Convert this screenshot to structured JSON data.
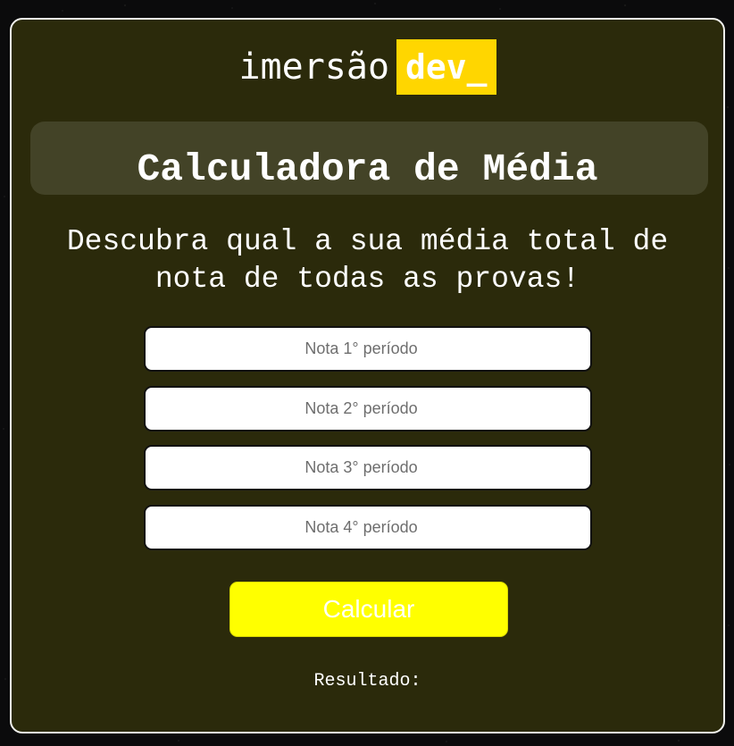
{
  "logo": {
    "text": "imersão",
    "badge": "dev_"
  },
  "title": "Calculadora de Média",
  "subtitle": "Descubra qual a sua média total de nota de todas as provas!",
  "inputs": [
    {
      "placeholder": "Nota 1° período",
      "value": ""
    },
    {
      "placeholder": "Nota 2° período",
      "value": ""
    },
    {
      "placeholder": "Nota 3° período",
      "value": ""
    },
    {
      "placeholder": "Nota 4° período",
      "value": ""
    }
  ],
  "button": {
    "label": "Calcular"
  },
  "result": {
    "label": "Resultado:"
  },
  "colors": {
    "card_background": "#2b2a0b",
    "title_bar": "#434327",
    "logo_badge": "#ffd600",
    "button": "#ffff00",
    "card_border": "#f2f2ee"
  }
}
